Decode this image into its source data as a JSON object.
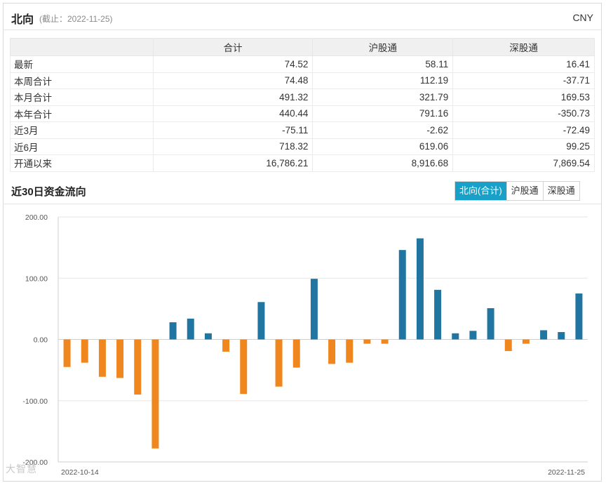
{
  "header": {
    "title": "北向",
    "cutoff": "(截止：2022-11-25)",
    "currency": "CNY"
  },
  "table": {
    "columns": [
      "",
      "合计",
      "沪股通",
      "深股通"
    ],
    "rows": [
      {
        "label": "最新",
        "total": "74.52",
        "sh": "58.11",
        "sz": "16.41"
      },
      {
        "label": "本周合计",
        "total": "74.48",
        "sh": "112.19",
        "sz": "-37.71"
      },
      {
        "label": "本月合计",
        "total": "491.32",
        "sh": "321.79",
        "sz": "169.53"
      },
      {
        "label": "本年合计",
        "total": "440.44",
        "sh": "791.16",
        "sz": "-350.73"
      },
      {
        "label": "近3月",
        "total": "-75.11",
        "sh": "-2.62",
        "sz": "-72.49"
      },
      {
        "label": "近6月",
        "total": "718.32",
        "sh": "619.06",
        "sz": "99.25"
      },
      {
        "label": "开通以来",
        "total": "16,786.21",
        "sh": "8,916.68",
        "sz": "7,869.54"
      }
    ]
  },
  "section": {
    "title": "近30日资金流向",
    "tabs": [
      {
        "label": "北向(合计)",
        "active": true
      },
      {
        "label": "沪股通",
        "active": false
      },
      {
        "label": "深股通",
        "active": false
      }
    ]
  },
  "watermark": "大智慧",
  "chart_data": {
    "type": "bar",
    "ylim": [
      -200,
      200
    ],
    "yticks": [
      "200.00",
      "100.00",
      "0.00",
      "-100.00",
      "-200.00"
    ],
    "ytick_values": [
      200,
      100,
      0,
      -100,
      -200
    ],
    "x_start_label": "2022-10-14",
    "x_end_label": "2022-11-25",
    "positive_color": "#2176a1",
    "negative_color": "#f0871e",
    "values": [
      -45,
      -38,
      -61,
      -63,
      -90,
      -178,
      28,
      34,
      10,
      -20,
      -89,
      61,
      -77,
      -46,
      99,
      -40,
      -38,
      -7,
      -7,
      146,
      165,
      81,
      10,
      14,
      51,
      -19,
      -7,
      15,
      12,
      75
    ]
  }
}
